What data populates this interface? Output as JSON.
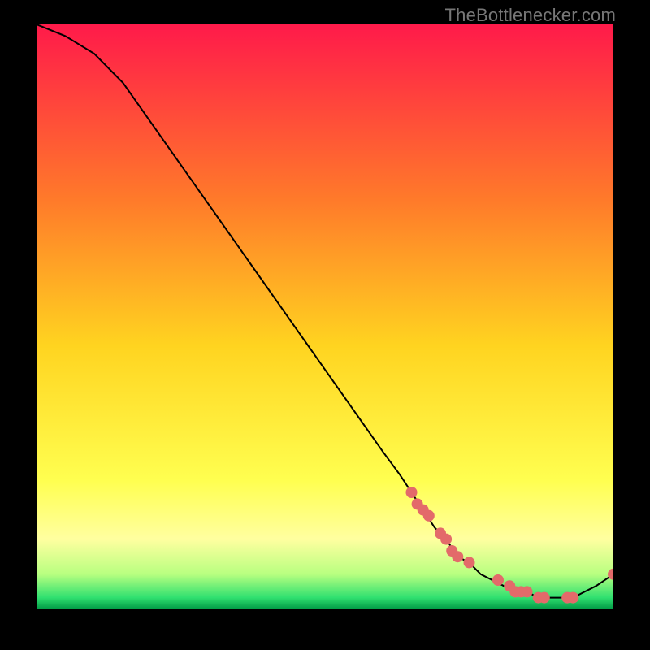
{
  "watermark": "TheBottlenecker.com",
  "chart_data": {
    "type": "line",
    "title": "",
    "xlabel": "",
    "ylabel": "",
    "xlim": [
      0,
      100
    ],
    "ylim": [
      0,
      100
    ],
    "grid": false,
    "series": [
      {
        "name": "curve",
        "x": [
          0,
          5,
          10,
          15,
          20,
          25,
          30,
          35,
          40,
          45,
          50,
          55,
          60,
          63,
          65,
          67,
          69,
          71,
          73,
          75,
          77,
          79,
          81,
          83,
          85,
          87,
          89,
          91,
          93,
          95,
          97,
          100
        ],
        "y": [
          100,
          98,
          95,
          90,
          83,
          76,
          69,
          62,
          55,
          48,
          41,
          34,
          27,
          23,
          20,
          17,
          14,
          12,
          9,
          8,
          6,
          5,
          4,
          3,
          3,
          2,
          2,
          2,
          2,
          3,
          4,
          6
        ]
      },
      {
        "name": "markers",
        "x": [
          65,
          66,
          67,
          68,
          70,
          71,
          72,
          73,
          75,
          80,
          82,
          83,
          84,
          85,
          87,
          88,
          92,
          93,
          100
        ],
        "y": [
          20,
          18,
          17,
          16,
          13,
          12,
          10,
          9,
          8,
          5,
          4,
          3,
          3,
          3,
          2,
          2,
          2,
          2,
          6
        ]
      }
    ],
    "marker_color": "#e36a6a",
    "line_color": "#000000",
    "gradient": {
      "top": "#ff1a4a",
      "mid1": "#ff7a2a",
      "mid2": "#ffd420",
      "yellow": "#ffff50",
      "lightyellow": "#ffffa0",
      "green1": "#b8ff80",
      "green2": "#30e070",
      "bottom": "#009944"
    }
  }
}
